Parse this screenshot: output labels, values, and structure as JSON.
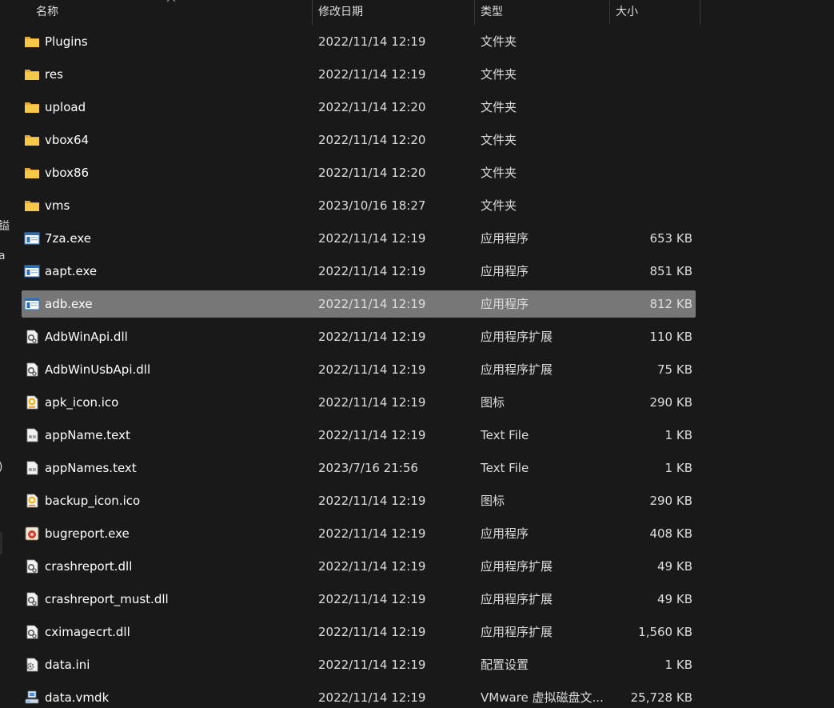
{
  "columns": {
    "name": "名称",
    "modified": "修改日期",
    "type": "类型",
    "size": "大小"
  },
  "edge_fragments": [
    "镒",
    "a",
    ")"
  ],
  "files": [
    {
      "name": "Plugins",
      "modified": "2022/11/14 12:19",
      "type": "文件夹",
      "size": "",
      "icon": "folder-icon"
    },
    {
      "name": "res",
      "modified": "2022/11/14 12:19",
      "type": "文件夹",
      "size": "",
      "icon": "folder-icon"
    },
    {
      "name": "upload",
      "modified": "2022/11/14 12:20",
      "type": "文件夹",
      "size": "",
      "icon": "folder-icon"
    },
    {
      "name": "vbox64",
      "modified": "2022/11/14 12:20",
      "type": "文件夹",
      "size": "",
      "icon": "folder-icon"
    },
    {
      "name": "vbox86",
      "modified": "2022/11/14 12:20",
      "type": "文件夹",
      "size": "",
      "icon": "folder-icon"
    },
    {
      "name": "vms",
      "modified": "2023/10/16 18:27",
      "type": "文件夹",
      "size": "",
      "icon": "folder-icon"
    },
    {
      "name": "7za.exe",
      "modified": "2022/11/14 12:19",
      "type": "应用程序",
      "size": "653 KB",
      "icon": "exe-icon"
    },
    {
      "name": "aapt.exe",
      "modified": "2022/11/14 12:19",
      "type": "应用程序",
      "size": "851 KB",
      "icon": "exe-icon"
    },
    {
      "name": "adb.exe",
      "modified": "2022/11/14 12:19",
      "type": "应用程序",
      "size": "812 KB",
      "icon": "exe-icon",
      "selected": true
    },
    {
      "name": "AdbWinApi.dll",
      "modified": "2022/11/14 12:19",
      "type": "应用程序扩展",
      "size": "110 KB",
      "icon": "dll-icon"
    },
    {
      "name": "AdbWinUsbApi.dll",
      "modified": "2022/11/14 12:19",
      "type": "应用程序扩展",
      "size": "75 KB",
      "icon": "dll-icon"
    },
    {
      "name": "apk_icon.ico",
      "modified": "2022/11/14 12:19",
      "type": "图标",
      "size": "290 KB",
      "icon": "ico-icon"
    },
    {
      "name": "appName.text",
      "modified": "2022/11/14 12:19",
      "type": "Text File",
      "size": "1 KB",
      "icon": "text-file-icon"
    },
    {
      "name": "appNames.text",
      "modified": "2023/7/16 21:56",
      "type": "Text File",
      "size": "1 KB",
      "icon": "text-file-icon"
    },
    {
      "name": "backup_icon.ico",
      "modified": "2022/11/14 12:19",
      "type": "图标",
      "size": "290 KB",
      "icon": "ico-icon"
    },
    {
      "name": "bugreport.exe",
      "modified": "2022/11/14 12:19",
      "type": "应用程序",
      "size": "408 KB",
      "icon": "bugreport-app-icon"
    },
    {
      "name": "crashreport.dll",
      "modified": "2022/11/14 12:19",
      "type": "应用程序扩展",
      "size": "49 KB",
      "icon": "dll-icon"
    },
    {
      "name": "crashreport_must.dll",
      "modified": "2022/11/14 12:19",
      "type": "应用程序扩展",
      "size": "49 KB",
      "icon": "dll-icon"
    },
    {
      "name": "cximagecrt.dll",
      "modified": "2022/11/14 12:19",
      "type": "应用程序扩展",
      "size": "1,560 KB",
      "icon": "dll-icon"
    },
    {
      "name": "data.ini",
      "modified": "2022/11/14 12:19",
      "type": "配置设置",
      "size": "1 KB",
      "icon": "ini-icon"
    },
    {
      "name": "data.vmdk",
      "modified": "2022/11/14 12:19",
      "type": "VMware 虚拟磁盘文...",
      "size": "25,728 KB",
      "icon": "vmdk-icon"
    }
  ],
  "colors": {
    "background": "#191919",
    "selected_row": "#777777",
    "folder": "#f4c542",
    "exe_accent": "#2b7fd4"
  }
}
